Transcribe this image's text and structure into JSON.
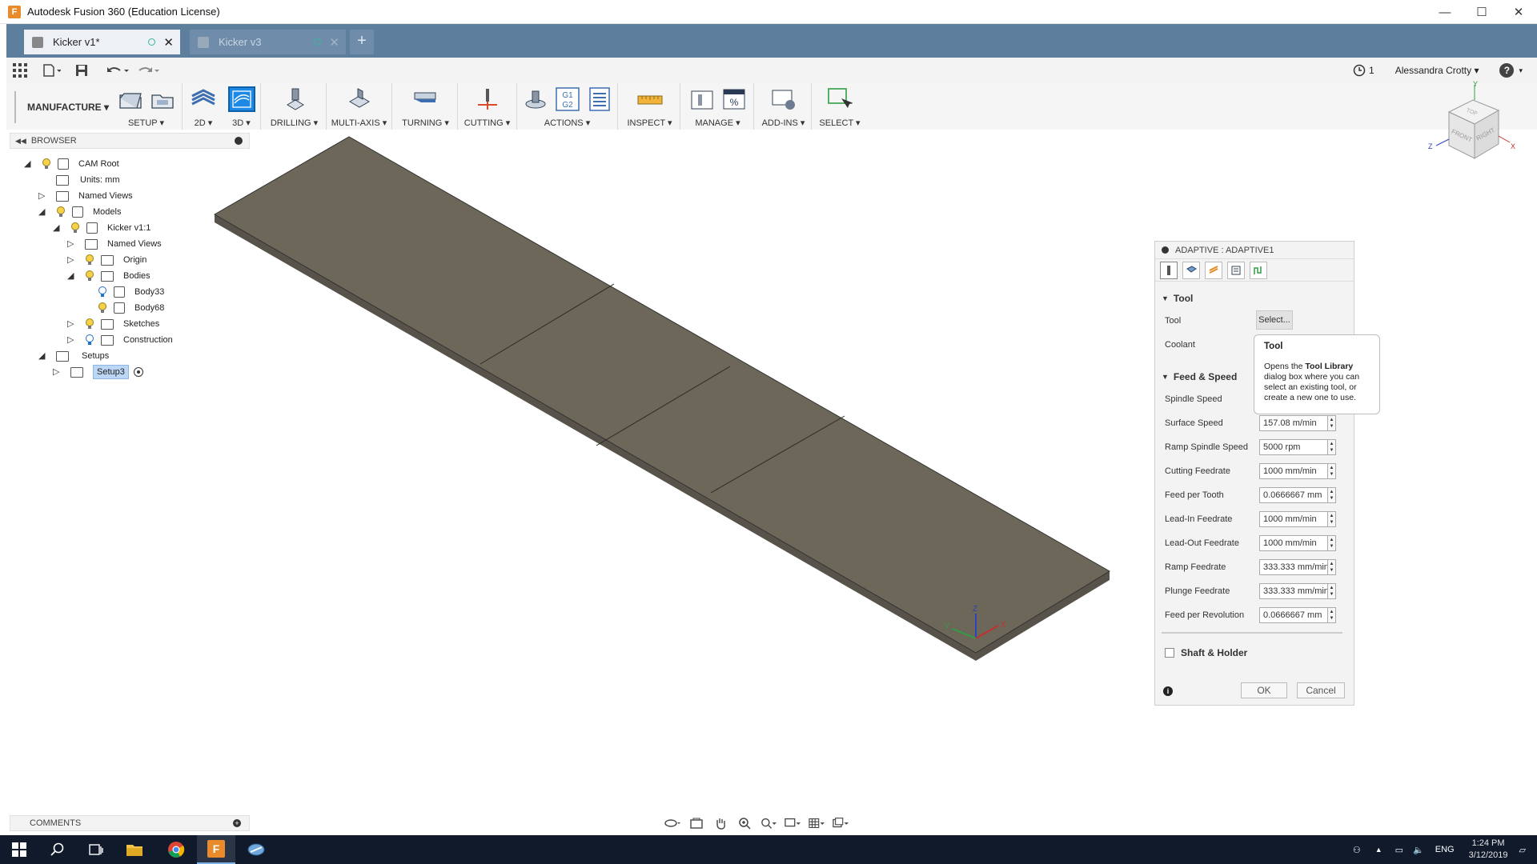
{
  "window": {
    "title": "Autodesk Fusion 360 (Education License)",
    "minimize": "—",
    "maximize": "☐",
    "close": "✕"
  },
  "tabs": [
    {
      "label": "Kicker v1*",
      "active": true
    },
    {
      "label": "Kicker v3",
      "active": false
    }
  ],
  "new_tab": "+",
  "qab": {
    "jobs_count": "1",
    "user": "Alessandra Crotty ▾",
    "help": "?"
  },
  "toolbar": {
    "workspace": "MANUFACTURE ▾",
    "groups": [
      {
        "label": "SETUP ▾"
      },
      {
        "label": "2D ▾"
      },
      {
        "label": "3D ▾"
      },
      {
        "label": "DRILLING ▾"
      },
      {
        "label": "MULTI-AXIS ▾"
      },
      {
        "label": "TURNING ▾"
      },
      {
        "label": "CUTTING ▾"
      },
      {
        "label": "ACTIONS ▾"
      },
      {
        "label": "INSPECT ▾"
      },
      {
        "label": "MANAGE ▾"
      },
      {
        "label": "ADD-INS ▾"
      },
      {
        "label": "SELECT ▾"
      }
    ]
  },
  "browser": {
    "title": "BROWSER",
    "nodes": [
      {
        "label": "CAM Root"
      },
      {
        "label": "Units: mm"
      },
      {
        "label": "Named Views"
      },
      {
        "label": "Models"
      },
      {
        "label": "Kicker v1:1"
      },
      {
        "label": "Named Views"
      },
      {
        "label": "Origin"
      },
      {
        "label": "Bodies"
      },
      {
        "label": "Body33"
      },
      {
        "label": "Body68"
      },
      {
        "label": "Sketches"
      },
      {
        "label": "Construction"
      },
      {
        "label": "Setups"
      },
      {
        "label": "Setup3"
      }
    ]
  },
  "viewcube": {
    "top": "TOP",
    "front": "FRONT",
    "right": "RIGHT",
    "x": "X",
    "y": "Y",
    "z": "Z"
  },
  "triad": {
    "x": "X",
    "y": "Y",
    "z": "Z"
  },
  "panel": {
    "title": "ADAPTIVE : ADAPTIVE1",
    "tool_section": "Tool",
    "tool_label": "Tool",
    "select_button": "Select...",
    "coolant_label": "Coolant",
    "feed_section": "Feed & Speed",
    "spindle_speed_label": "Spindle Speed",
    "rows": [
      {
        "label": "Surface Speed",
        "value": "157.08 m/min"
      },
      {
        "label": "Ramp Spindle Speed",
        "value": "5000 rpm"
      },
      {
        "label": "Cutting Feedrate",
        "value": "1000 mm/min"
      },
      {
        "label": "Feed per Tooth",
        "value": "0.0666667 mm"
      },
      {
        "label": "Lead-In Feedrate",
        "value": "1000 mm/min"
      },
      {
        "label": "Lead-Out Feedrate",
        "value": "1000 mm/min"
      },
      {
        "label": "Ramp Feedrate",
        "value": "333.333 mm/min"
      },
      {
        "label": "Plunge Feedrate",
        "value": "333.333 mm/min"
      },
      {
        "label": "Feed per Revolution",
        "value": "0.0666667 mm"
      }
    ],
    "shaft_holder": "Shaft & Holder",
    "ok": "OK",
    "cancel": "Cancel"
  },
  "tooltip": {
    "title": "Tool",
    "text_before": "Opens the ",
    "text_bold": "Tool Library",
    "text_after": " dialog box where you can select an existing tool, or create a new one to use."
  },
  "comments": {
    "title": "COMMENTS"
  },
  "taskbar": {
    "lang": "ENG",
    "time": "1:24 PM",
    "date": "3/12/2019"
  },
  "colors": {
    "tab_strip": "#5d7e9c",
    "model_top": "#6c6758",
    "model_side": "#57534a",
    "accent": "#1e88e5"
  }
}
